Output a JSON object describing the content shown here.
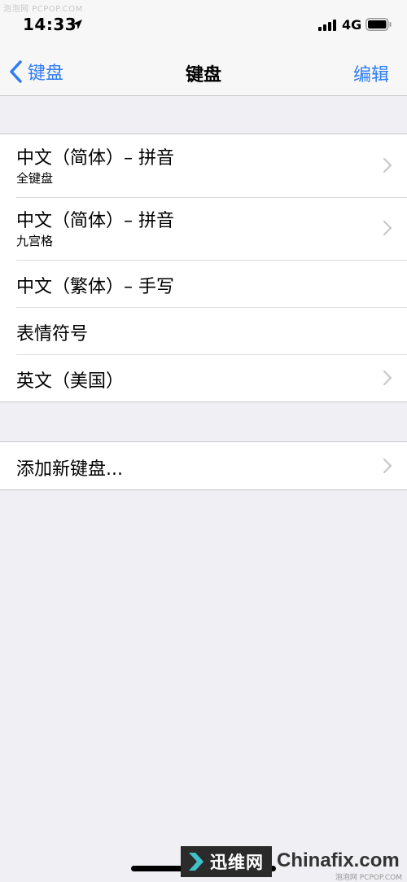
{
  "watermark_top": "泡泡网 PCPOP.COM",
  "status_bar": {
    "time": "14:33",
    "network": "4G"
  },
  "nav": {
    "back_label": "键盘",
    "title": "键盘",
    "edit_label": "编辑"
  },
  "keyboards": {
    "items": [
      {
        "title": "中文（简体）– 拼音",
        "subtitle": "全键盘"
      },
      {
        "title": "中文（简体）– 拼音",
        "subtitle": "九宫格"
      },
      {
        "title": "中文（繁体）– 手写"
      },
      {
        "title": "表情符号"
      },
      {
        "title": "英文（美国）"
      }
    ]
  },
  "add_keyboard": {
    "label": "添加新键盘..."
  },
  "brand_watermark": {
    "cn": "迅维网",
    "en": "Chinafix.com",
    "sub": "泡泡网 PCPOP.COM"
  },
  "colors": {
    "accent": "#2f7cf6",
    "background": "#efeff4",
    "separator": "#c8c7cc",
    "chevron": "#c7c7cc",
    "brand_arrow": "#3fc1c9"
  }
}
